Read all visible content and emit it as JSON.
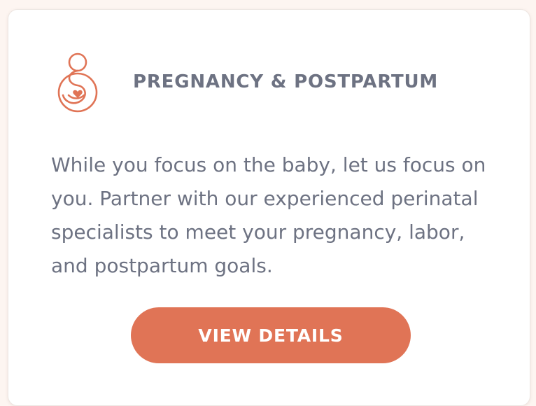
{
  "card": {
    "icon": "pregnancy-icon",
    "title": "PREGNANCY & POSTPARTUM",
    "description": "While you focus on the baby, let us focus on you. Partner with our experienced perinatal specialists to meet your pregnancy, labor, and postpartum goals.",
    "button_label": "VIEW DETAILS"
  },
  "colors": {
    "background": "#fdf5f1",
    "card": "#ffffff",
    "accent": "#e07456",
    "text": "#6d7282"
  }
}
